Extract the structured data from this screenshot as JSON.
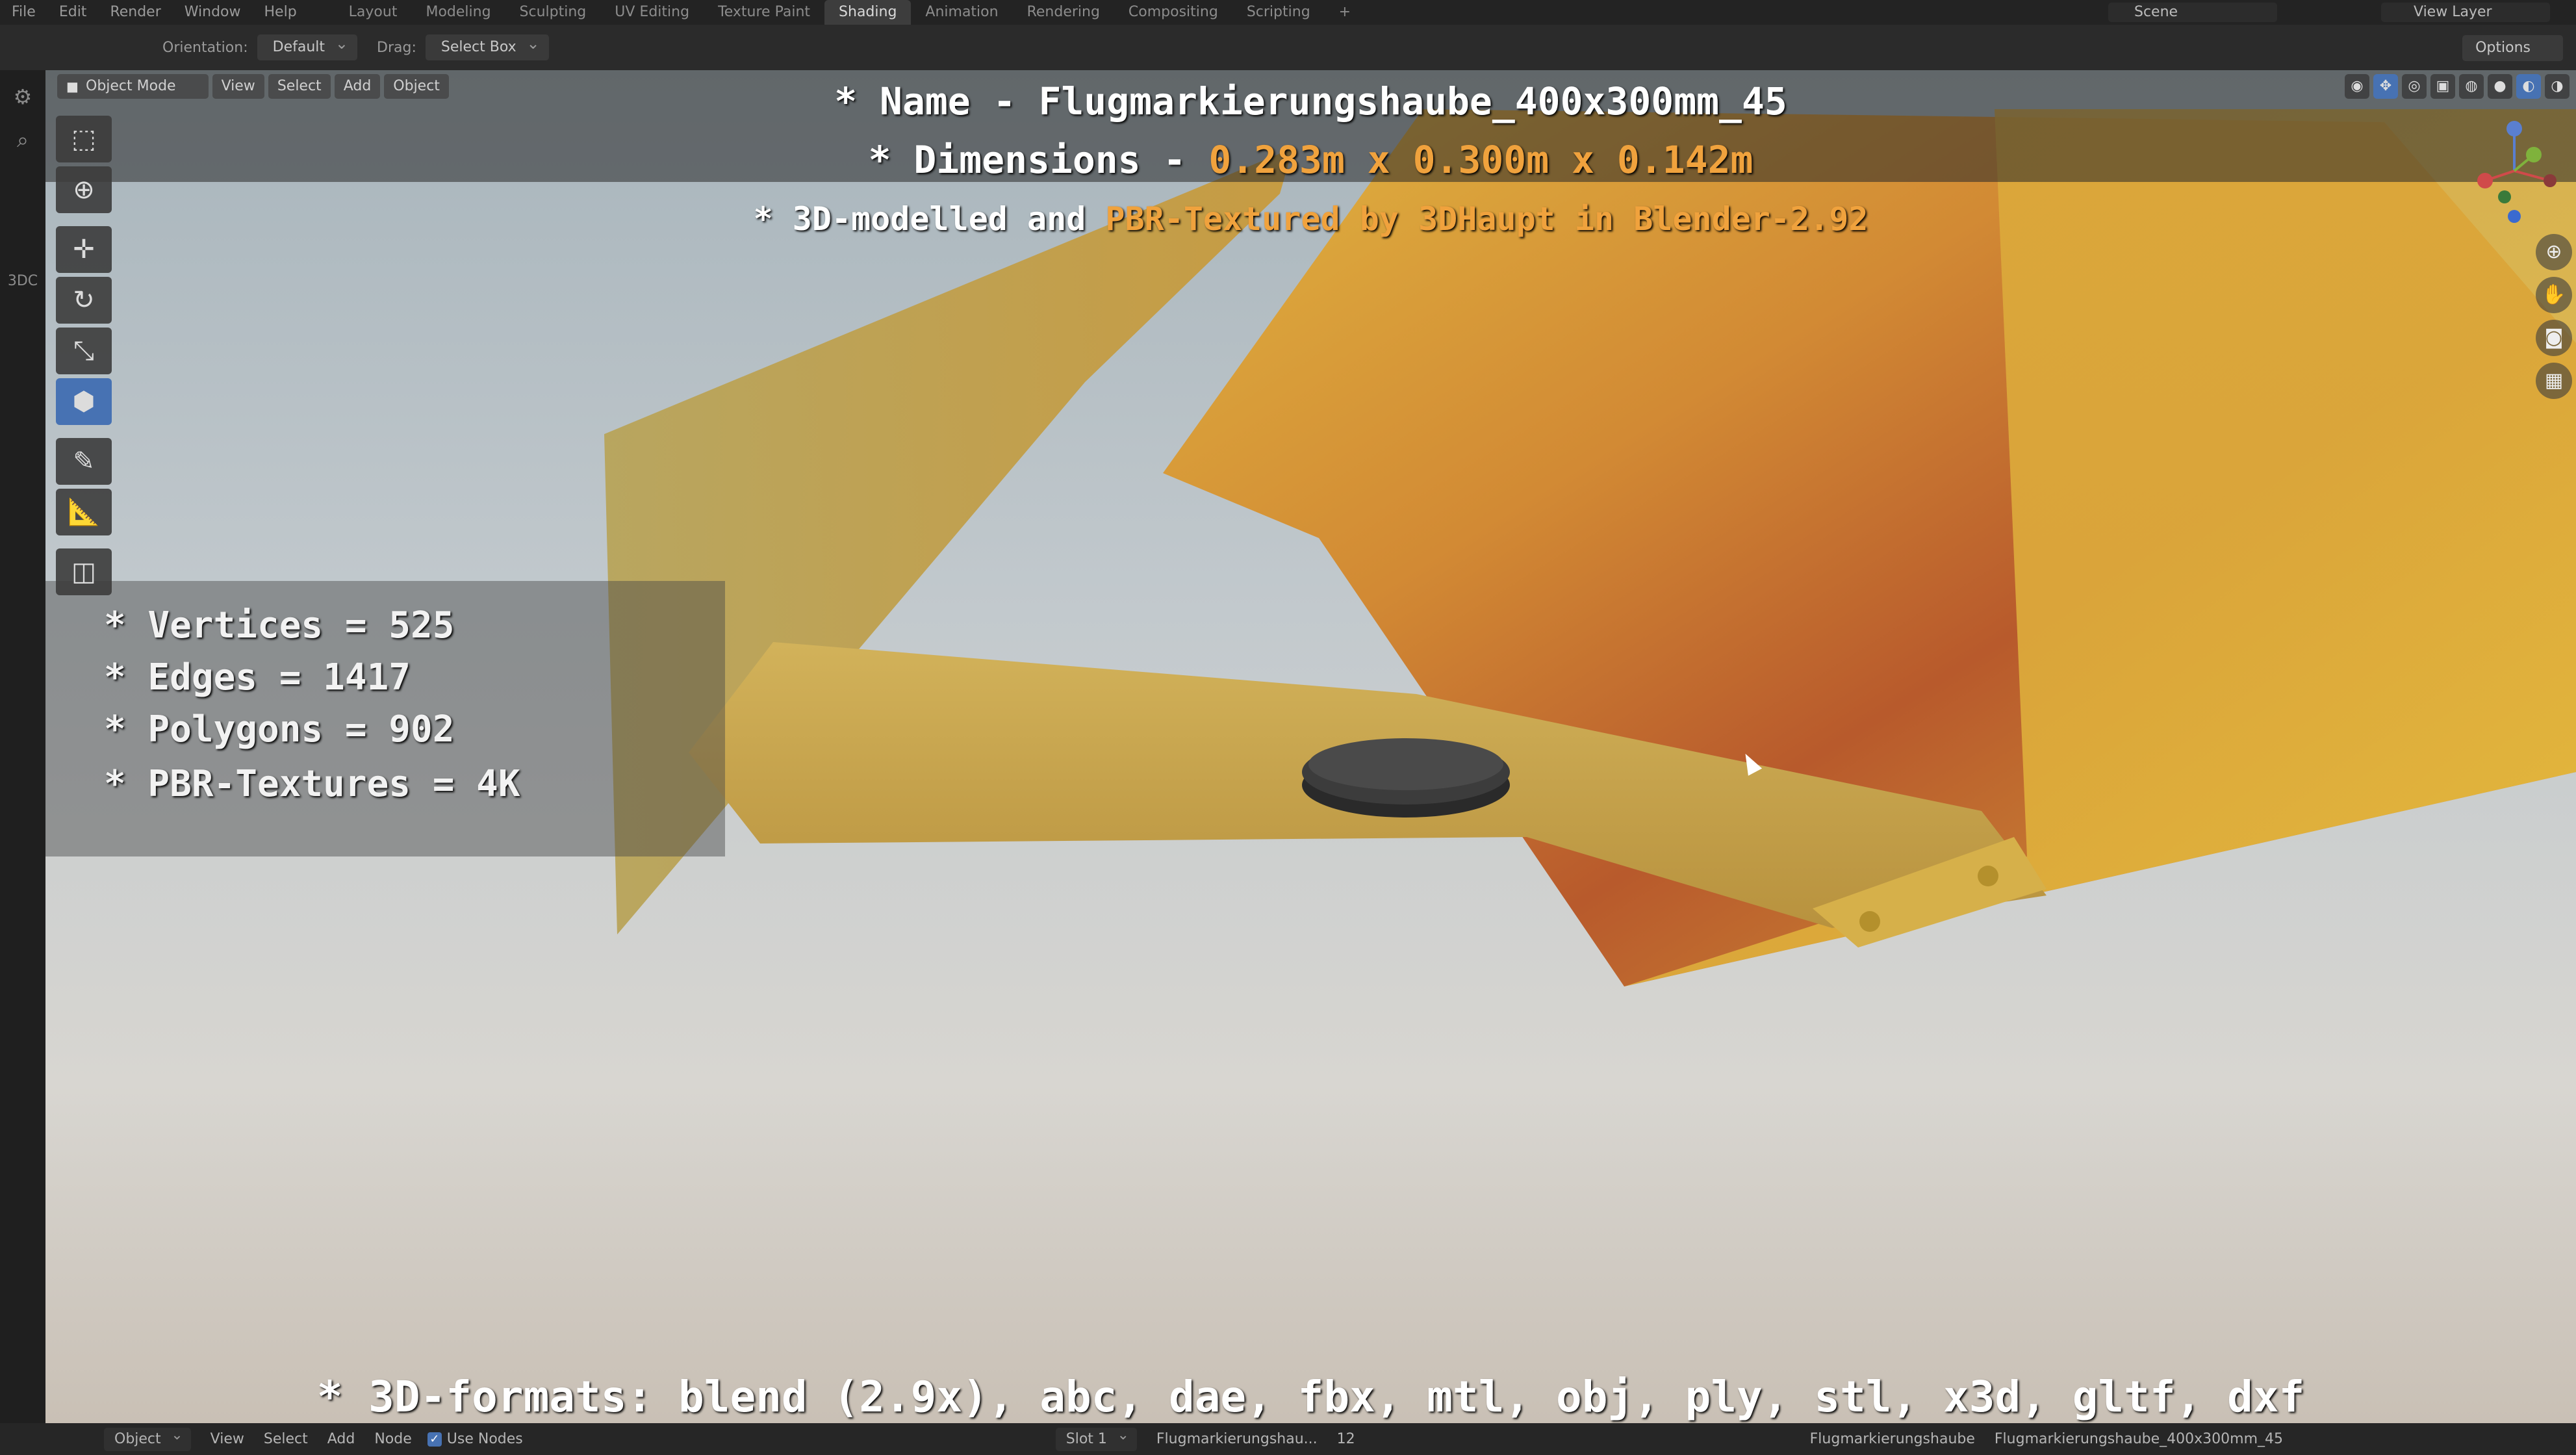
{
  "topbar": {
    "menus": [
      "File",
      "Edit",
      "Render",
      "Window",
      "Help"
    ],
    "workspace_tabs": [
      "Layout",
      "Modeling",
      "Sculpting",
      "UV Editing",
      "Texture Paint",
      "Shading",
      "Animation",
      "Rendering",
      "Compositing",
      "Scripting"
    ],
    "active_tab": "Shading",
    "scene": "Scene",
    "view_layer": "View Layer"
  },
  "tool_settings": {
    "orientation_label": "Orientation:",
    "orientation_value": "Default",
    "drag_label": "Drag:",
    "drag_value": "Select Box",
    "options_label": "Options"
  },
  "viewport_header": {
    "mode": "Object Mode",
    "view": "View",
    "select": "Select",
    "add": "Add",
    "object": "Object"
  },
  "overlay": {
    "name_prefix": "* Name - ",
    "name_value": "Flugmarkierungshaube_400x300mm_45",
    "dims_prefix": "* Dimensions - ",
    "dims_value": "0.283m x 0.300m x 0.142m",
    "credit_prefix": "* 3D-modelled and ",
    "credit_pbr": "PBR-Textured by 3DHaupt in Blender-2.92",
    "stats": [
      "* Vertices = 525",
      "* Edges = 1417",
      "* Polygons = 902",
      "* PBR-Textures = 4K"
    ],
    "formats": "* 3D-formats: blend (2.9x), abc, dae, fbx, mtl, obj, ply, stl, x3d, gltf, dxf"
  },
  "left_strip": {
    "label": "3DC"
  },
  "bottombar": {
    "object": "Object",
    "view": "View",
    "select": "Select",
    "add": "Add",
    "node": "Node",
    "use_nodes": "Use Nodes",
    "slot": "Slot 1",
    "material": "Flugmarkierungshau...",
    "users": "12",
    "object_name": "Flugmarkierungshaube",
    "mesh_name": "Flugmarkierungshaube_400x300mm_45"
  },
  "colors": {
    "accent": "#4772b3",
    "highlight_text": "#f0a23d",
    "object_yellow": "#d6a838",
    "object_shadow": "#b0522a"
  }
}
